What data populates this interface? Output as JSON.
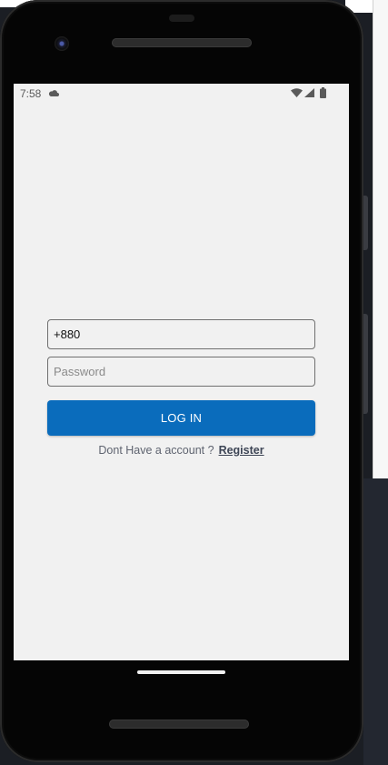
{
  "status_bar": {
    "time": "7:58",
    "icons": [
      "cloud-icon",
      "wifi-icon",
      "signal-icon",
      "battery-icon"
    ]
  },
  "login_form": {
    "phone_value": "+880",
    "password_placeholder": "Password",
    "login_label": "LOG IN",
    "no_account_text": "Dont Have a account ?",
    "register_label": "Register"
  },
  "colors": {
    "screen_background": "#f1f1f1",
    "primary_button": "#0a6cbc",
    "field_border": "#707070"
  }
}
